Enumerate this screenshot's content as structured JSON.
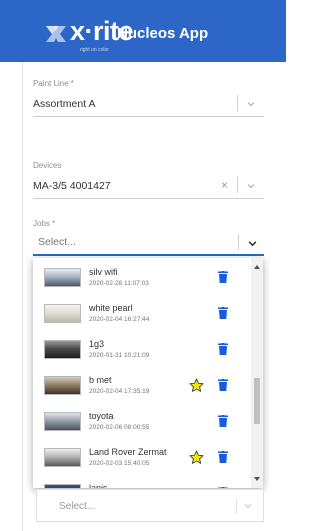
{
  "header": {
    "logo_text": "x·rite",
    "logo_tagline": "right on color",
    "app_title": "Nucleos App",
    "background": "#2c67c8"
  },
  "paint_line": {
    "label": "Paint Line *",
    "value": "Assortment A"
  },
  "devices": {
    "label": "Devices",
    "value": "MA-3/5 4001427",
    "clear_icon": "×"
  },
  "jobs": {
    "label": "Jobs *",
    "placeholder": "Select...",
    "items": [
      {
        "name": "silv wifi",
        "date": "2020-02-28 11:07:03",
        "favorite": false,
        "swatch": "metallic-silver-blue"
      },
      {
        "name": "white pearl",
        "date": "2020-02-04 16:27:44",
        "favorite": false,
        "swatch": "pearl-white"
      },
      {
        "name": "1g3",
        "date": "2020-01-31 10:21:09",
        "favorite": false,
        "swatch": "dark-grey"
      },
      {
        "name": "b met",
        "date": "2020-02-04 17:35:19",
        "favorite": true,
        "swatch": "brown-metallic"
      },
      {
        "name": "toyota",
        "date": "2020-02-06 08:00:55",
        "favorite": false,
        "swatch": "grey-blue-metallic"
      },
      {
        "name": "Land Rover Zermat",
        "date": "2020-02-03 15:40:05",
        "favorite": true,
        "swatch": "silver-grey"
      },
      {
        "name": "lapis",
        "date": "",
        "favorite": false,
        "swatch": "deep-blue"
      }
    ]
  },
  "bottom_select": {
    "placeholder": "Select..."
  },
  "colors": {
    "accent": "#2c67c8",
    "trash": "#1a5bd6",
    "star_fill": "#f5e50f",
    "star_stroke": "#333333"
  }
}
